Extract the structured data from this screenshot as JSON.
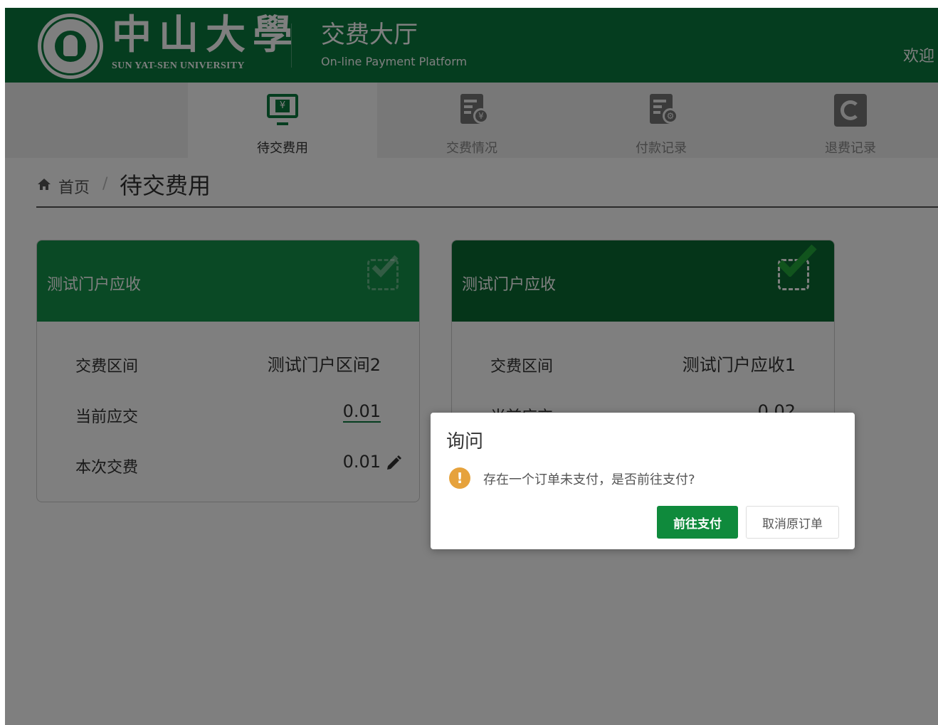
{
  "header": {
    "logo_cn": "中山大學",
    "logo_en": "SUN YAT-SEN UNIVERSITY",
    "platform_cn": "交费大厅",
    "platform_en": "On-line Payment Platform",
    "welcome": "欢迎"
  },
  "nav": {
    "items": [
      {
        "label": "待交费用",
        "icon": "monitor-yuan-icon",
        "active": true
      },
      {
        "label": "交费情况",
        "icon": "bill-yuan-icon",
        "active": false
      },
      {
        "label": "付款记录",
        "icon": "bill-settings-icon",
        "active": false
      },
      {
        "label": "退费记录",
        "icon": "refund-icon",
        "active": false
      }
    ]
  },
  "breadcrumb": {
    "home": "首页",
    "separator": "/",
    "current": "待交费用"
  },
  "cards": [
    {
      "title": "测试门户应收",
      "selected": false,
      "rows": [
        {
          "key": "交费区间",
          "value": "测试门户区间2"
        },
        {
          "key": "当前应交",
          "value": "0.01"
        },
        {
          "key": "本次交费",
          "value": "0.01"
        }
      ]
    },
    {
      "title": "测试门户应收",
      "selected": true,
      "rows": [
        {
          "key": "交费区间",
          "value": "测试门户应收1"
        },
        {
          "key": "当前应交",
          "value": "0.02"
        }
      ]
    }
  ],
  "dialog": {
    "title": "询问",
    "message": "存在一个订单未支付，是否前往支付?",
    "confirm_label": "前往支付",
    "cancel_label": "取消原订单"
  },
  "colors": {
    "brand_green": "#0a7a3e",
    "card_head_light": "#15924a",
    "card_head_dark": "#0a6a32",
    "warning": "#e6a23c"
  }
}
